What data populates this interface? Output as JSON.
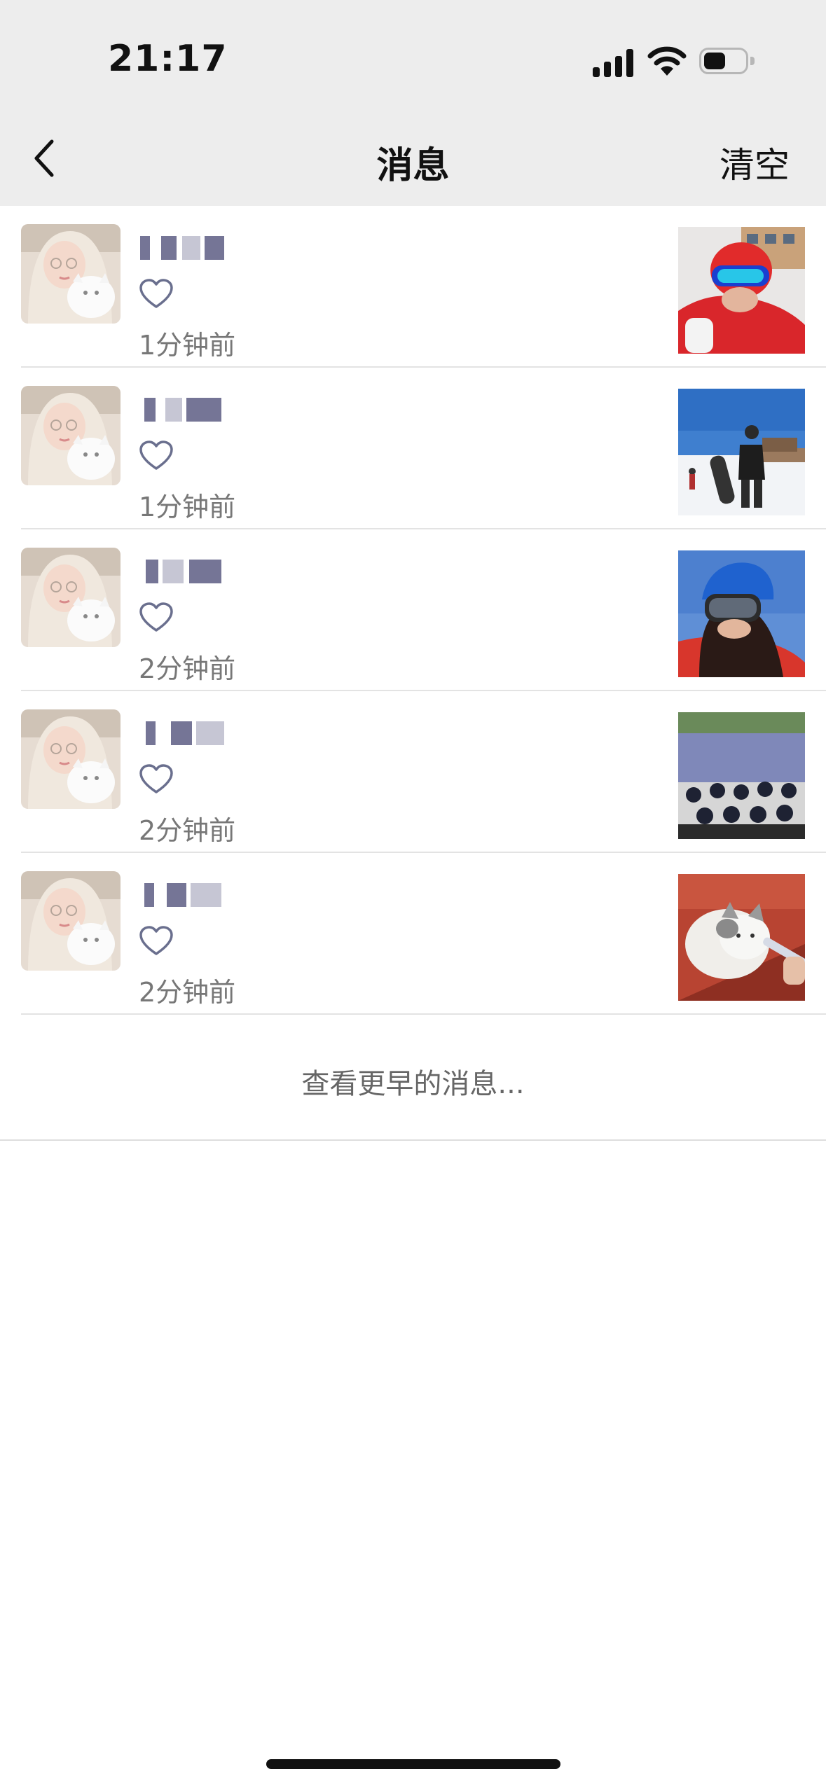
{
  "status_bar": {
    "time": "21:17"
  },
  "nav": {
    "title": "消息",
    "clear_label": "清空"
  },
  "messages": [
    {
      "type": "like",
      "time": "1分钟前",
      "icon": "heart-outline-icon",
      "thumbnail": "skier-red-helmet-photo"
    },
    {
      "type": "like",
      "time": "1分钟前",
      "icon": "heart-outline-icon",
      "thumbnail": "snowboarder-photo"
    },
    {
      "type": "like",
      "time": "2分钟前",
      "icon": "heart-outline-icon",
      "thumbnail": "skier-blue-helmet-photo"
    },
    {
      "type": "like",
      "time": "2分钟前",
      "icon": "heart-outline-icon",
      "thumbnail": "go-kart-group-photo"
    },
    {
      "type": "like",
      "time": "2分钟前",
      "icon": "heart-outline-icon",
      "thumbnail": "cat-photo"
    }
  ],
  "footer": {
    "more_label": "查看更早的消息..."
  },
  "colors": {
    "header_bg": "#ededed",
    "heart": "#6a6f8e",
    "time_text": "#777777",
    "divider": "#e3e3e3"
  }
}
